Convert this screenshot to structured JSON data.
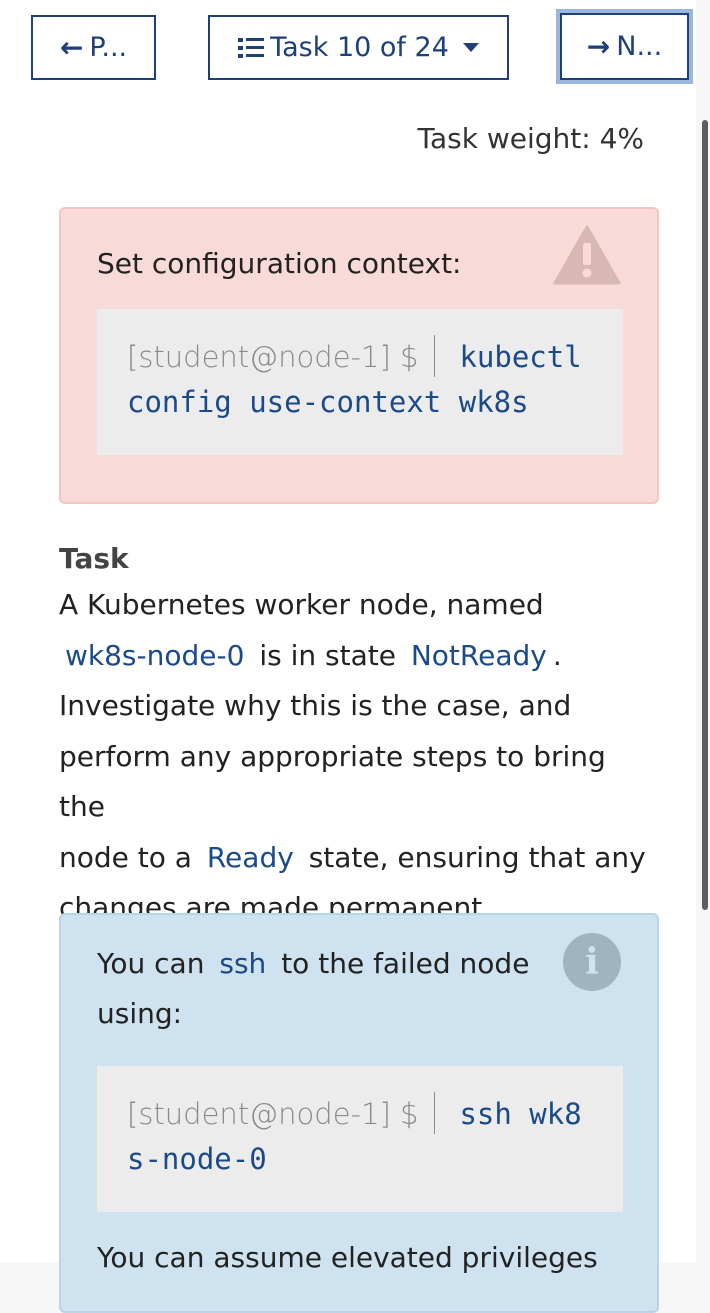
{
  "nav": {
    "prev_label": "P...",
    "task_label": "Task 10 of 24",
    "next_label": "N..."
  },
  "weight_text": "Task weight: 4%",
  "context_alert": {
    "text": "Set configuration context:",
    "prompt": "[student@node-1] $",
    "command_line1": "kubectl",
    "command_line2": "config use-context wk8s"
  },
  "task": {
    "heading": "Task",
    "p1": "A Kubernetes worker node, named",
    "node_name": "wk8s-node-0",
    "p2": "is in state",
    "state": "NotReady",
    "p3": ".",
    "p4": "Investigate why this is the case, and",
    "p5": "perform any appropriate steps to bring the",
    "p6": "node to a",
    "ready": "Ready",
    "p7": "state, ensuring that any",
    "p8": "changes are made permanent."
  },
  "info_alert": {
    "t1": "You can",
    "ssh": "ssh",
    "t2": "to the failed node",
    "t3": "using:",
    "prompt": "[student@node-1] $",
    "command_line1": "ssh wk8",
    "command_line2": "s-node-0",
    "trailing": "You can assume elevated privileges"
  },
  "colors": {
    "accent": "#1d3f7a",
    "danger_bg": "#f8dbd8",
    "info_bg": "#cfe2f0",
    "code_text": "#1a4a8a"
  }
}
